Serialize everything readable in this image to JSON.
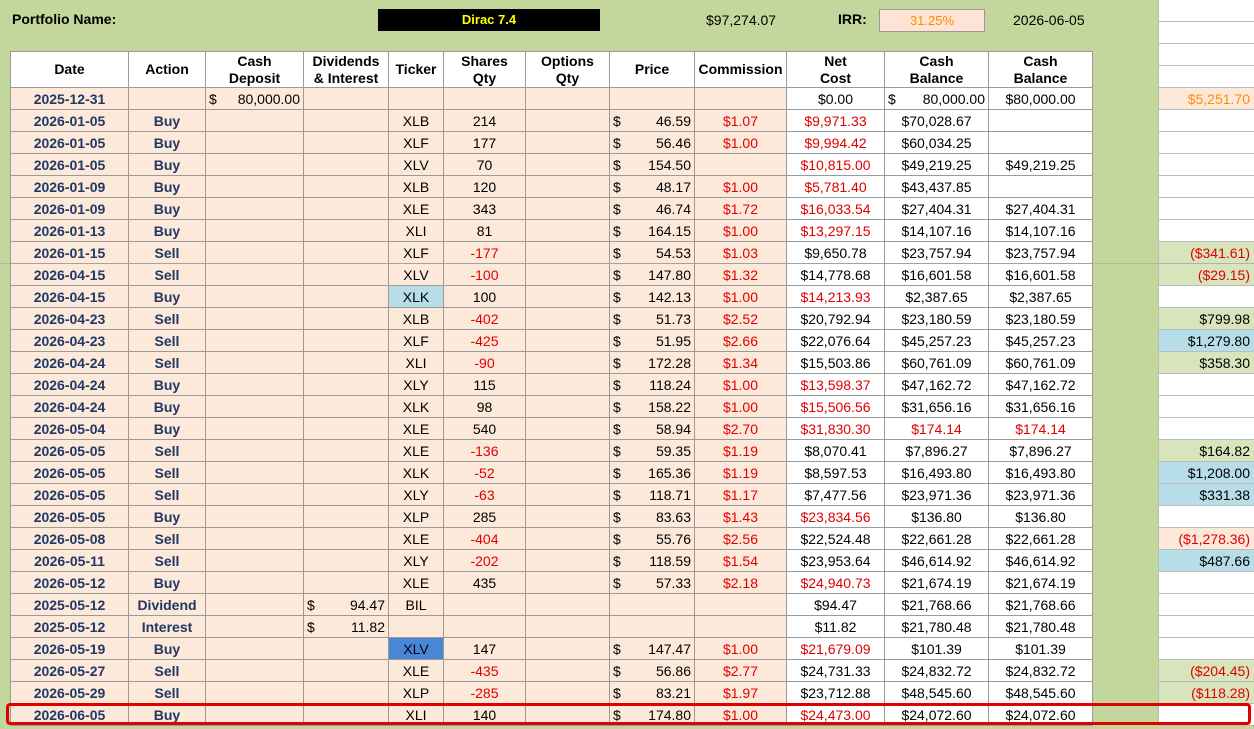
{
  "header": {
    "portfolio_label": "Portfolio Name:",
    "portfolio_name": "Dirac 7.4",
    "total_value": "$97,274.07",
    "irr_label": "IRR:",
    "irr_value": "31.25%",
    "report_date": "2026-06-05"
  },
  "columns": [
    "Date",
    "Action",
    "Cash Deposit",
    "Dividends & Interest",
    "Ticker",
    "Shares Qty",
    "Options Qty",
    "Price",
    "Commission",
    "Net Cost",
    "Cash Balance",
    "Cash Balance"
  ],
  "rows": [
    {
      "date": "2025-12-31",
      "action": "",
      "deposit": "80,000.00",
      "div": "",
      "ticker": "",
      "shares": "",
      "options": "",
      "price": "",
      "commission": "",
      "net": "$0.00",
      "cash": "80,000.00",
      "cash2": "$80,000.00",
      "side": "$5,251.70",
      "side_color": "#ff8c00",
      "side_bg": "#fde9d9",
      "net_neg": false,
      "shares_neg": false,
      "cash_neg": false,
      "cash_dollar": true,
      "deposit_dollar": true
    },
    {
      "date": "2026-01-05",
      "action": "Buy",
      "deposit": "",
      "div": "",
      "ticker": "XLB",
      "shares": "214",
      "options": "",
      "price": "46.59",
      "commission": "$1.07",
      "net": "$9,971.33",
      "cash": "$70,028.67",
      "cash2": "",
      "side": "",
      "net_neg": true
    },
    {
      "date": "2026-01-05",
      "action": "Buy",
      "deposit": "",
      "div": "",
      "ticker": "XLF",
      "shares": "177",
      "options": "",
      "price": "56.46",
      "commission": "$1.00",
      "net": "$9,994.42",
      "cash": "$60,034.25",
      "cash2": "",
      "side": "",
      "net_neg": true
    },
    {
      "date": "2026-01-05",
      "action": "Buy",
      "deposit": "",
      "div": "",
      "ticker": "XLV",
      "shares": "70",
      "options": "",
      "price": "154.50",
      "commission": "",
      "net": "$10,815.00",
      "cash": "$49,219.25",
      "cash2": "$49,219.25",
      "side": "",
      "net_neg": true
    },
    {
      "date": "2026-01-09",
      "action": "Buy",
      "deposit": "",
      "div": "",
      "ticker": "XLB",
      "shares": "120",
      "options": "",
      "price": "48.17",
      "commission": "$1.00",
      "net": "$5,781.40",
      "cash": "$43,437.85",
      "cash2": "",
      "side": "",
      "net_neg": true
    },
    {
      "date": "2026-01-09",
      "action": "Buy",
      "deposit": "",
      "div": "",
      "ticker": "XLE",
      "shares": "343",
      "options": "",
      "price": "46.74",
      "commission": "$1.72",
      "net": "$16,033.54",
      "cash": "$27,404.31",
      "cash2": "$27,404.31",
      "side": "",
      "net_neg": true
    },
    {
      "date": "2026-01-13",
      "action": "Buy",
      "deposit": "",
      "div": "",
      "ticker": "XLI",
      "shares": "81",
      "options": "",
      "price": "164.15",
      "commission": "$1.00",
      "net": "$13,297.15",
      "cash": "$14,107.16",
      "cash2": "$14,107.16",
      "side": "",
      "net_neg": true
    },
    {
      "date": "2026-01-15",
      "action": "Sell",
      "deposit": "",
      "div": "",
      "ticker": "XLF",
      "shares": "-177",
      "options": "",
      "price": "54.53",
      "commission": "$1.03",
      "net": "$9,650.78",
      "cash": "$23,757.94",
      "cash2": "$23,757.94",
      "side": "($341.61)",
      "side_color": "#e00000",
      "side_bg": "#d8e4bc",
      "shares_neg": true
    },
    {
      "date": "2026-04-15",
      "action": "Sell",
      "deposit": "",
      "div": "",
      "ticker": "XLV",
      "shares": "-100",
      "options": "",
      "price": "147.80",
      "commission": "$1.32",
      "net": "$14,778.68",
      "cash": "$16,601.58",
      "cash2": "$16,601.58",
      "side": "($29.15)",
      "side_color": "#e00000",
      "side_bg": "#d8e4bc",
      "shares_neg": true
    },
    {
      "date": "2026-04-15",
      "action": "Buy",
      "deposit": "",
      "div": "",
      "ticker": "XLK",
      "shares": "100",
      "options": "",
      "price": "142.13",
      "commission": "$1.00",
      "net": "$14,213.93",
      "cash": "$2,387.65",
      "cash2": "$2,387.65",
      "side": "",
      "net_neg": true,
      "ticker_bg": "#b7dde8"
    },
    {
      "date": "2026-04-23",
      "action": "Sell",
      "deposit": "",
      "div": "",
      "ticker": "XLB",
      "shares": "-402",
      "options": "",
      "price": "51.73",
      "commission": "$2.52",
      "net": "$20,792.94",
      "cash": "$23,180.59",
      "cash2": "$23,180.59",
      "side": "$799.98",
      "side_color": "#000",
      "side_bg": "#d8e4bc",
      "shares_neg": true
    },
    {
      "date": "2026-04-23",
      "action": "Sell",
      "deposit": "",
      "div": "",
      "ticker": "XLF",
      "shares": "-425",
      "options": "",
      "price": "51.95",
      "commission": "$2.66",
      "net": "$22,076.64",
      "cash": "$45,257.23",
      "cash2": "$45,257.23",
      "side": "$1,279.80",
      "side_color": "#000",
      "side_bg": "#b7dde8",
      "shares_neg": true
    },
    {
      "date": "2026-04-24",
      "action": "Sell",
      "deposit": "",
      "div": "",
      "ticker": "XLI",
      "shares": "-90",
      "options": "",
      "price": "172.28",
      "commission": "$1.34",
      "net": "$15,503.86",
      "cash": "$60,761.09",
      "cash2": "$60,761.09",
      "side": "$358.30",
      "side_color": "#000",
      "side_bg": "#d8e4bc",
      "shares_neg": true
    },
    {
      "date": "2026-04-24",
      "action": "Buy",
      "deposit": "",
      "div": "",
      "ticker": "XLY",
      "shares": "115",
      "options": "",
      "price": "118.24",
      "commission": "$1.00",
      "net": "$13,598.37",
      "cash": "$47,162.72",
      "cash2": "$47,162.72",
      "side": "",
      "net_neg": true
    },
    {
      "date": "2026-04-24",
      "action": "Buy",
      "deposit": "",
      "div": "",
      "ticker": "XLK",
      "shares": "98",
      "options": "",
      "price": "158.22",
      "commission": "$1.00",
      "net": "$15,506.56",
      "cash": "$31,656.16",
      "cash2": "$31,656.16",
      "side": "",
      "net_neg": true
    },
    {
      "date": "2026-05-04",
      "action": "Buy",
      "deposit": "",
      "div": "",
      "ticker": "XLE",
      "shares": "540",
      "options": "",
      "price": "58.94",
      "commission": "$2.70",
      "net": "$31,830.30",
      "cash": "$174.14",
      "cash2": "$174.14",
      "side": "",
      "net_neg": true,
      "cash_neg": true
    },
    {
      "date": "2026-05-05",
      "action": "Sell",
      "deposit": "",
      "div": "",
      "ticker": "XLE",
      "shares": "-136",
      "options": "",
      "price": "59.35",
      "commission": "$1.19",
      "net": "$8,070.41",
      "cash": "$7,896.27",
      "cash2": "$7,896.27",
      "side": "$164.82",
      "side_color": "#000",
      "side_bg": "#d8e4bc",
      "shares_neg": true
    },
    {
      "date": "2026-05-05",
      "action": "Sell",
      "deposit": "",
      "div": "",
      "ticker": "XLK",
      "shares": "-52",
      "options": "",
      "price": "165.36",
      "commission": "$1.19",
      "net": "$8,597.53",
      "cash": "$16,493.80",
      "cash2": "$16,493.80",
      "side": "$1,208.00",
      "side_color": "#000",
      "side_bg": "#b7dde8",
      "shares_neg": true
    },
    {
      "date": "2026-05-05",
      "action": "Sell",
      "deposit": "",
      "div": "",
      "ticker": "XLY",
      "shares": "-63",
      "options": "",
      "price": "118.71",
      "commission": "$1.17",
      "net": "$7,477.56",
      "cash": "$23,971.36",
      "cash2": "$23,971.36",
      "side": "$331.38",
      "side_color": "#000",
      "side_bg": "#b7dde8",
      "shares_neg": true
    },
    {
      "date": "2026-05-05",
      "action": "Buy",
      "deposit": "",
      "div": "",
      "ticker": "XLP",
      "shares": "285",
      "options": "",
      "price": "83.63",
      "commission": "$1.43",
      "net": "$23,834.56",
      "cash": "$136.80",
      "cash2": "$136.80",
      "side": "",
      "net_neg": true
    },
    {
      "date": "2026-05-08",
      "action": "Sell",
      "deposit": "",
      "div": "",
      "ticker": "XLE",
      "shares": "-404",
      "options": "",
      "price": "55.76",
      "commission": "$2.56",
      "net": "$22,524.48",
      "cash": "$22,661.28",
      "cash2": "$22,661.28",
      "side": "($1,278.36)",
      "side_color": "#e00000",
      "side_bg": "#fde9d9",
      "shares_neg": true
    },
    {
      "date": "2026-05-11",
      "action": "Sell",
      "deposit": "",
      "div": "",
      "ticker": "XLY",
      "shares": "-202",
      "options": "",
      "price": "118.59",
      "commission": "$1.54",
      "net": "$23,953.64",
      "cash": "$46,614.92",
      "cash2": "$46,614.92",
      "side": "$487.66",
      "side_color": "#000",
      "side_bg": "#b7dde8",
      "shares_neg": true
    },
    {
      "date": "2026-05-12",
      "action": "Buy",
      "deposit": "",
      "div": "",
      "ticker": "XLE",
      "shares": "435",
      "options": "",
      "price": "57.33",
      "commission": "$2.18",
      "net": "$24,940.73",
      "cash": "$21,674.19",
      "cash2": "$21,674.19",
      "side": "",
      "net_neg": true
    },
    {
      "date": "2025-05-12",
      "action": "Dividend",
      "deposit": "",
      "div": "94.47",
      "ticker": "BIL",
      "shares": "",
      "options": "",
      "price": "",
      "commission": "",
      "net": "$94.47",
      "cash": "$21,768.66",
      "cash2": "$21,768.66",
      "side": "",
      "div_dollar": true
    },
    {
      "date": "2025-05-12",
      "action": "Interest",
      "deposit": "",
      "div": "11.82",
      "ticker": "",
      "shares": "",
      "options": "",
      "price": "",
      "commission": "",
      "net": "$11.82",
      "cash": "$21,780.48",
      "cash2": "$21,780.48",
      "side": "",
      "div_dollar": true
    },
    {
      "date": "2026-05-19",
      "action": "Buy",
      "deposit": "",
      "div": "",
      "ticker": "XLV",
      "shares": "147",
      "options": "",
      "price": "147.47",
      "commission": "$1.00",
      "net": "$21,679.09",
      "cash": "$101.39",
      "cash2": "$101.39",
      "side": "",
      "net_neg": true,
      "ticker_bg": "#4a86d8"
    },
    {
      "date": "2026-05-27",
      "action": "Sell",
      "deposit": "",
      "div": "",
      "ticker": "XLE",
      "shares": "-435",
      "options": "",
      "price": "56.86",
      "commission": "$2.77",
      "net": "$24,731.33",
      "cash": "$24,832.72",
      "cash2": "$24,832.72",
      "side": "($204.45)",
      "side_color": "#e00000",
      "side_bg": "#d8e4bc",
      "shares_neg": true
    },
    {
      "date": "2026-05-29",
      "action": "Sell",
      "deposit": "",
      "div": "",
      "ticker": "XLP",
      "shares": "-285",
      "options": "",
      "price": "83.21",
      "commission": "$1.97",
      "net": "$23,712.88",
      "cash": "$48,545.60",
      "cash2": "$48,545.60",
      "side": "($118.28)",
      "side_color": "#e00000",
      "side_bg": "#d8e4bc",
      "shares_neg": true
    },
    {
      "date": "2026-06-05",
      "action": "Buy",
      "deposit": "",
      "div": "",
      "ticker": "XLI",
      "shares": "140",
      "options": "",
      "price": "174.80",
      "commission": "$1.00",
      "net": "$24,473.00",
      "cash": "$24,072.60",
      "cash2": "$24,072.60",
      "side": "",
      "net_neg": true
    }
  ],
  "colors": {
    "negative": "#e00000",
    "row_bg": "#fde9d9",
    "sheet_bg": "#c3d69b",
    "highlight": "#e00000"
  }
}
